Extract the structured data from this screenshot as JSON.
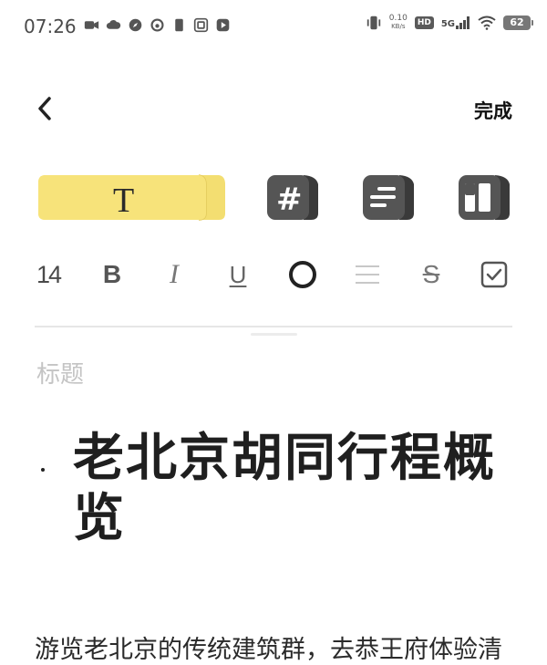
{
  "status_bar": {
    "time": "07:26",
    "net_speed_value": "0.10",
    "net_speed_unit": "KB/s",
    "hd": "HD",
    "network": "5G",
    "battery": "62",
    "icons": [
      "camera-icon",
      "cloud-icon",
      "compass-icon",
      "netease-music-icon",
      "sim-icon",
      "copy-icon",
      "play-icon",
      "vibrate-icon",
      "wifi-icon"
    ]
  },
  "header": {
    "back_icon": "chevron-left-icon",
    "done_label": "完成"
  },
  "style_tabs": {
    "items": [
      {
        "name": "text",
        "glyph": "T",
        "active": true
      },
      {
        "name": "hashtag",
        "glyph": "#",
        "active": false
      },
      {
        "name": "list",
        "glyph": "list-lines",
        "active": false
      },
      {
        "name": "columns",
        "glyph": "columns",
        "active": false
      }
    ],
    "active_color": "#F7E37A",
    "inactive_color": "#555555"
  },
  "format_bar": {
    "font_size": "14",
    "bold": "B",
    "italic": "I",
    "underline": "U",
    "strike": "S"
  },
  "editor": {
    "title_placeholder": "标题",
    "heading": "老北京胡同行程概览",
    "body": "游览老北京的传统建筑群，去恭王府体验清"
  }
}
